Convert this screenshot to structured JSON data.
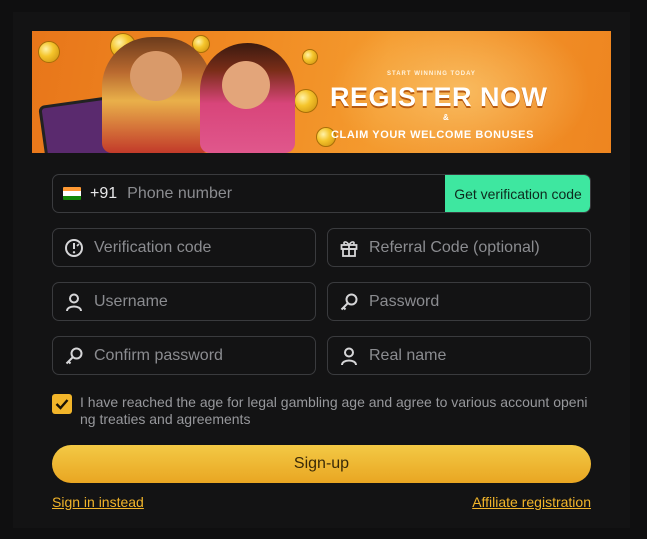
{
  "banner": {
    "small_text": "START WINNING TODAY",
    "title": "REGISTER NOW",
    "ampersand": "&",
    "subtitle": "CLAIM YOUR WELCOME BONUSES"
  },
  "phone": {
    "flag": "india-flag-icon",
    "country_code": "+91",
    "placeholder": "Phone number",
    "verify_label": "Get verification code"
  },
  "fields": {
    "verification_placeholder": "Verification code",
    "referral_placeholder": "Referral Code (optional)",
    "username_placeholder": "Username",
    "password_placeholder": "Password",
    "confirm_placeholder": "Confirm password",
    "realname_placeholder": "Real name"
  },
  "agreement": {
    "checked": true,
    "text": "I have reached the age for legal gambling age and agree to various account opening treaties and agreements"
  },
  "signup_label": "Sign-up",
  "links": {
    "signin": "Sign in instead",
    "affiliate": "Affiliate registration"
  },
  "colors": {
    "accent": "#f2b52a",
    "verify_button": "#3ee7a0",
    "background": "#131314"
  }
}
